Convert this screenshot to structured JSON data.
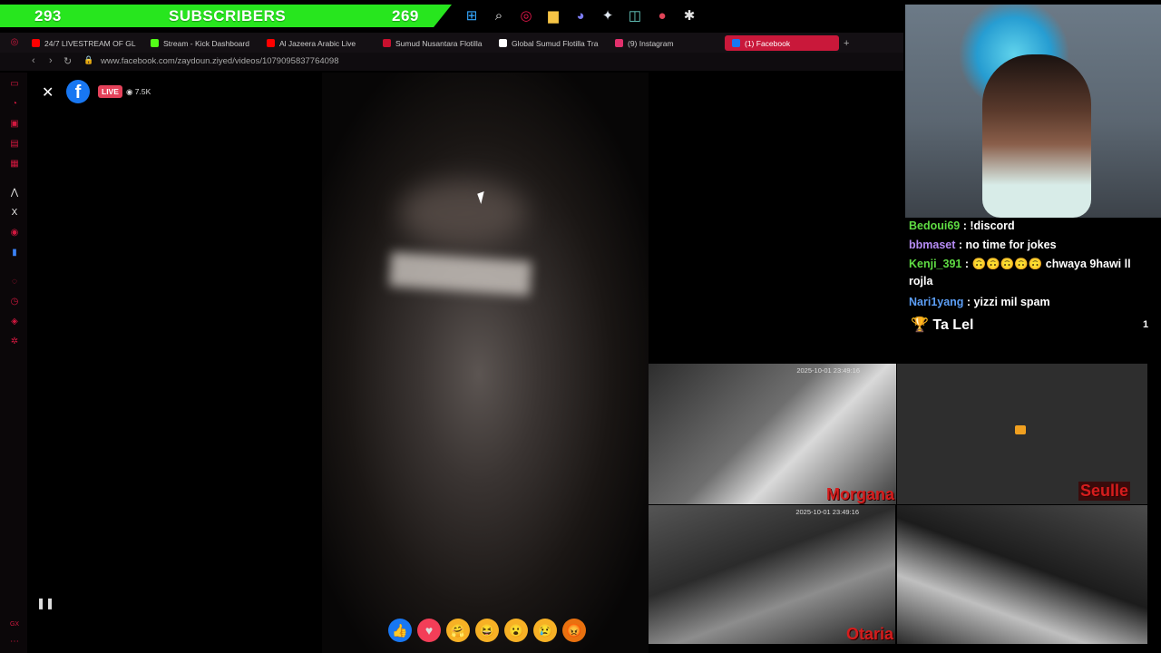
{
  "subscriber_bar": {
    "left_count": "293",
    "label": "SUBSCRIBERS",
    "right_count": "269",
    "color": "#27e61e"
  },
  "taskbar": [
    {
      "name": "windows-start-icon",
      "glyph": "⊞",
      "color": "#35a8ff"
    },
    {
      "name": "search-icon",
      "glyph": "⌕",
      "color": "#e8e8e8"
    },
    {
      "name": "opera-gx-icon",
      "glyph": "◎",
      "color": "#e5174a"
    },
    {
      "name": "file-explorer-icon",
      "glyph": "▆",
      "color": "#f6c445"
    },
    {
      "name": "discord-icon",
      "glyph": "◕",
      "color": "#7c7cf4"
    },
    {
      "name": "steam-icon",
      "glyph": "✦",
      "color": "#dfe7ef"
    },
    {
      "name": "app-icon",
      "glyph": "◫",
      "color": "#6ad1c6"
    },
    {
      "name": "location-icon",
      "glyph": "●",
      "color": "#e04458"
    },
    {
      "name": "settings-icon",
      "glyph": "✱",
      "color": "#e2e2e2"
    }
  ],
  "tabs": [
    {
      "label": "24/7 LIVESTREAM OF GL",
      "color": "#ff0000"
    },
    {
      "label": "Stream - Kick Dashboard",
      "color": "#53fc18"
    },
    {
      "label": "Al Jazeera Arabic Live",
      "color": "#ff0000"
    },
    {
      "label": "Sumud Nusantara Flotilla",
      "color": "#c8102e"
    },
    {
      "label": "Global Sumud Flotilla Tra",
      "color": "#ffffff"
    },
    {
      "label": "(9) Instagram",
      "color": "#e1306c"
    },
    {
      "label": "(1) Facebook",
      "color": "#1877f2"
    }
  ],
  "address": {
    "url": "www.facebook.com/zaydoun.ziyed/videos/1079095837764098"
  },
  "video": {
    "live_label": "LIVE",
    "viewers": "7.5K",
    "close": "✕"
  },
  "reactions": [
    {
      "name": "like-reaction-icon",
      "glyph": "👍",
      "bg": "#1877f2"
    },
    {
      "name": "love-reaction-icon",
      "glyph": "♥",
      "bg": "#f33e58"
    },
    {
      "name": "care-reaction-icon",
      "glyph": "🤗",
      "bg": "#f7b125"
    },
    {
      "name": "haha-reaction-icon",
      "glyph": "😆",
      "bg": "#f7b125"
    },
    {
      "name": "wow-reaction-icon",
      "glyph": "😮",
      "bg": "#f7b125"
    },
    {
      "name": "sad-reaction-icon",
      "glyph": "😢",
      "bg": "#f7b125"
    },
    {
      "name": "angry-reaction-icon",
      "glyph": "😡",
      "bg": "#e9710f"
    }
  ],
  "chat": [
    {
      "user": "Bedoui69",
      "text": " : !discord",
      "color": "#5fdc43",
      "top": "0"
    },
    {
      "user": "bbmaset",
      "text": " : no time for jokes",
      "color": "#b68cf5",
      "top": "1"
    },
    {
      "user": "Kenji_391",
      "text": " : 🙃🙃🙃🙃🙃 chwaya 9hawi ll rojla",
      "color": "#5fdc43",
      "top": "2"
    },
    {
      "user": "Nari1yang",
      "text": " : yizzi mil spam",
      "color": "#5c9ef5",
      "top": "3"
    }
  ],
  "winner": {
    "icon": "🏆",
    "name": "Ta Lel",
    "count": "1"
  },
  "cams": [
    {
      "name": "Morgana",
      "timestamp": "2025-10-01 23:49:16"
    },
    {
      "name": "Seulle",
      "timestamp": ""
    },
    {
      "name": "Otaria",
      "timestamp": "2025-10-01 23:49:16"
    },
    {
      "name": "",
      "timestamp": ""
    }
  ]
}
